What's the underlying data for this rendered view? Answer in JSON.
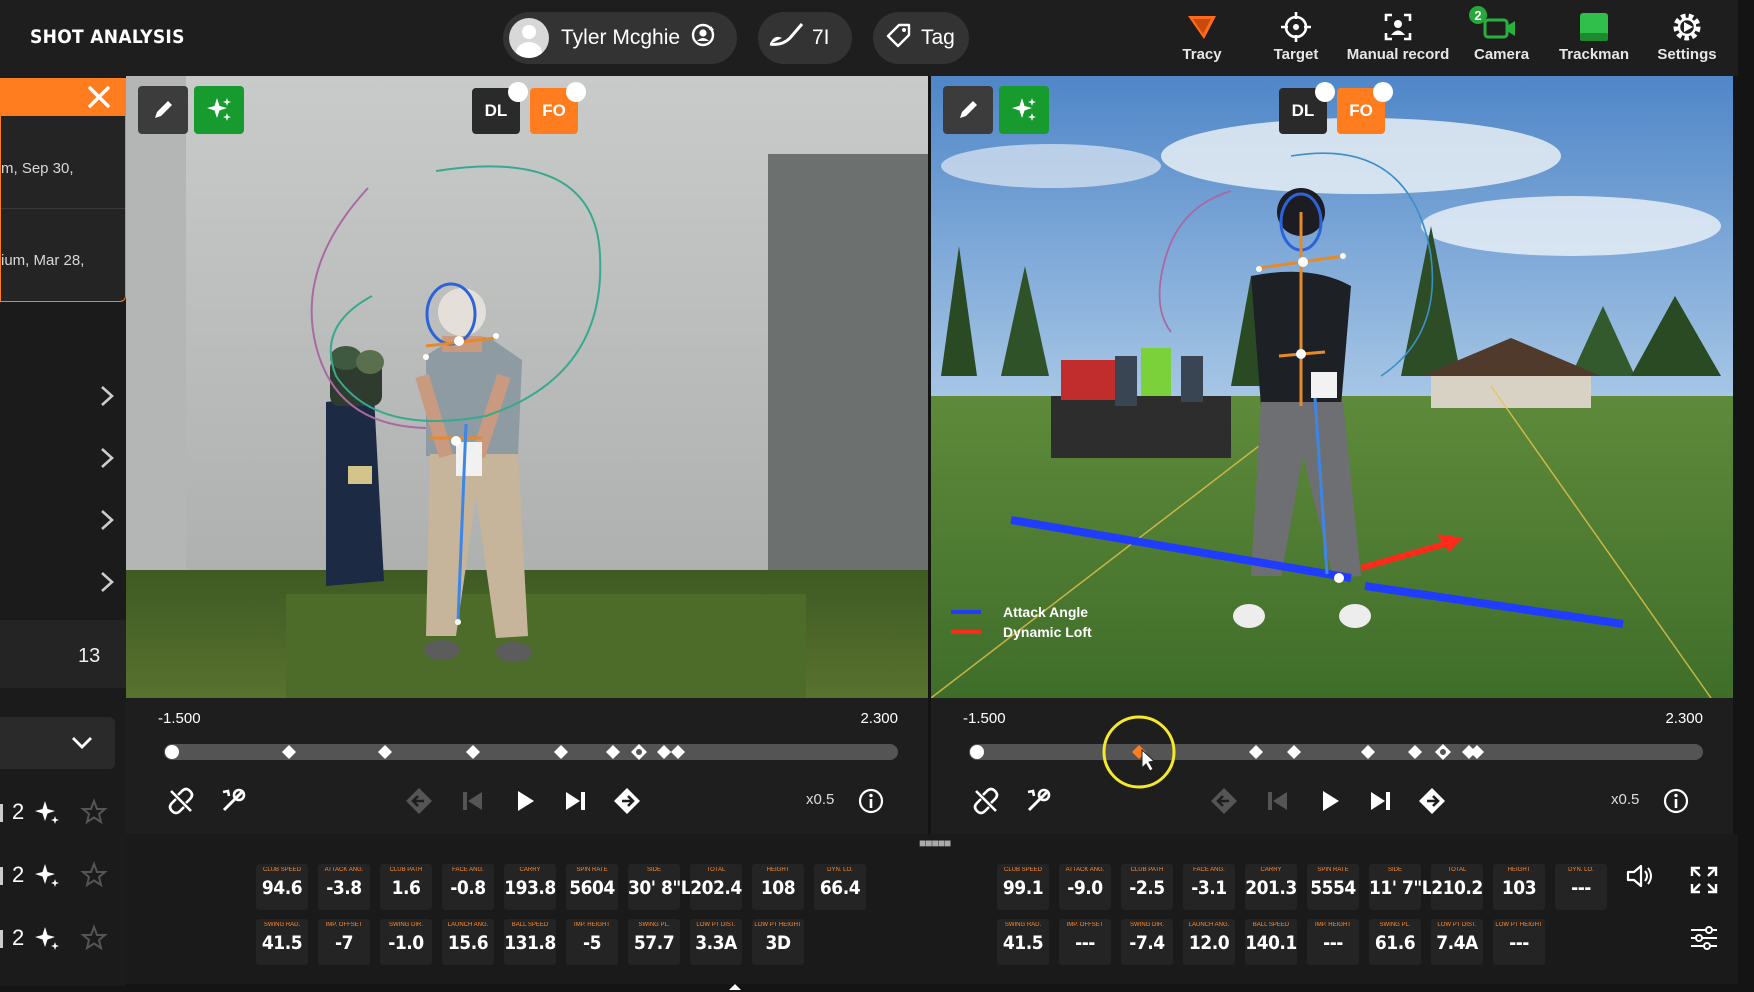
{
  "app": {
    "title": "SHOT ANALYSIS"
  },
  "header": {
    "player_name": "Tyler Mcghie",
    "club": "7I",
    "tag_label": "Tag",
    "tools": [
      {
        "label": "Tracy",
        "icon": "tracy-icon"
      },
      {
        "label": "Target",
        "icon": "crosshair-icon"
      },
      {
        "label": "Manual record",
        "icon": "manual-record-icon"
      },
      {
        "label": "Camera",
        "icon": "camera-icon",
        "badge": "2"
      },
      {
        "label": "Trackman",
        "icon": "trackman-icon"
      },
      {
        "label": "Settings",
        "icon": "gear-icon"
      }
    ]
  },
  "sidebar": {
    "entries": [
      "m, Sep 30,",
      "ium, Mar 28,"
    ],
    "count": "13",
    "shots": [
      {
        "number": "2"
      },
      {
        "number": "2"
      },
      {
        "number": "2"
      }
    ]
  },
  "panes": {
    "left": {
      "cameras": [
        "DL",
        "FO"
      ],
      "timeline": {
        "min": "-1.500",
        "max": "2.300",
        "speed": "x0.5"
      }
    },
    "right": {
      "cameras": [
        "DL",
        "FO"
      ],
      "legend": [
        {
          "label": "Attack Angle",
          "color": "#1f3cff"
        },
        {
          "label": "Dynamic Loft",
          "color": "#ff2a1a"
        }
      ],
      "timeline": {
        "min": "-1.500",
        "max": "2.300",
        "speed": "x0.5"
      }
    }
  },
  "stats": {
    "left": {
      "row1": [
        {
          "label": "CLUB SPEED",
          "value": "94.6"
        },
        {
          "label": "ATTACK ANG.",
          "value": "-3.8"
        },
        {
          "label": "CLUB PATH",
          "value": "1.6"
        },
        {
          "label": "FACE ANG.",
          "value": "-0.8"
        },
        {
          "label": "CARRY",
          "value": "193.8"
        },
        {
          "label": "SPIN RATE",
          "value": "5604"
        },
        {
          "label": "SIDE",
          "value": "30' 8\"L"
        },
        {
          "label": "TOTAL",
          "value": "202.4"
        },
        {
          "label": "HEIGHT",
          "value": "108"
        },
        {
          "label": "DYN. LO.",
          "value": "66.4"
        }
      ],
      "row2": [
        {
          "label": "SWING RAD.",
          "value": "41.5"
        },
        {
          "label": "IMP. OFFSET",
          "value": "-7"
        },
        {
          "label": "SWING DIR.",
          "value": "-1.0"
        },
        {
          "label": "LAUNCH ANG.",
          "value": "15.6"
        },
        {
          "label": "BALL SPEED",
          "value": "131.8"
        },
        {
          "label": "IMP. HEIGHT",
          "value": "-5"
        },
        {
          "label": "SWING PL.",
          "value": "57.7"
        },
        {
          "label": "LOW PT DIST.",
          "value": "3.3A"
        },
        {
          "label": "LOW PT HEIGHT",
          "value": "3D"
        }
      ]
    },
    "right": {
      "row1": [
        {
          "label": "CLUB SPEED",
          "value": "99.1"
        },
        {
          "label": "ATTACK ANG.",
          "value": "-9.0"
        },
        {
          "label": "CLUB PATH",
          "value": "-2.5"
        },
        {
          "label": "FACE ANG.",
          "value": "-3.1"
        },
        {
          "label": "CARRY",
          "value": "201.3"
        },
        {
          "label": "SPIN RATE",
          "value": "5554"
        },
        {
          "label": "SIDE",
          "value": "11' 7\"L"
        },
        {
          "label": "TOTAL",
          "value": "210.2"
        },
        {
          "label": "HEIGHT",
          "value": "103"
        },
        {
          "label": "DYN. LO.",
          "value": "---"
        }
      ],
      "row2": [
        {
          "label": "SWING RAD.",
          "value": "41.5"
        },
        {
          "label": "IMP. OFFSET",
          "value": "---"
        },
        {
          "label": "SWING DIR.",
          "value": "-7.4"
        },
        {
          "label": "LAUNCH ANG.",
          "value": "12.0"
        },
        {
          "label": "BALL SPEED",
          "value": "140.1"
        },
        {
          "label": "IMP. HEIGHT",
          "value": "---"
        },
        {
          "label": "SWING PL.",
          "value": "61.6"
        },
        {
          "label": "LOW PT DIST.",
          "value": "7.4A"
        },
        {
          "label": "LOW PT HEIGHT",
          "value": "---"
        }
      ]
    }
  },
  "colors": {
    "accent": "#ff7d1e",
    "ai_green": "#179a2e",
    "background": "#141414",
    "panel": "#1e1e1e"
  }
}
